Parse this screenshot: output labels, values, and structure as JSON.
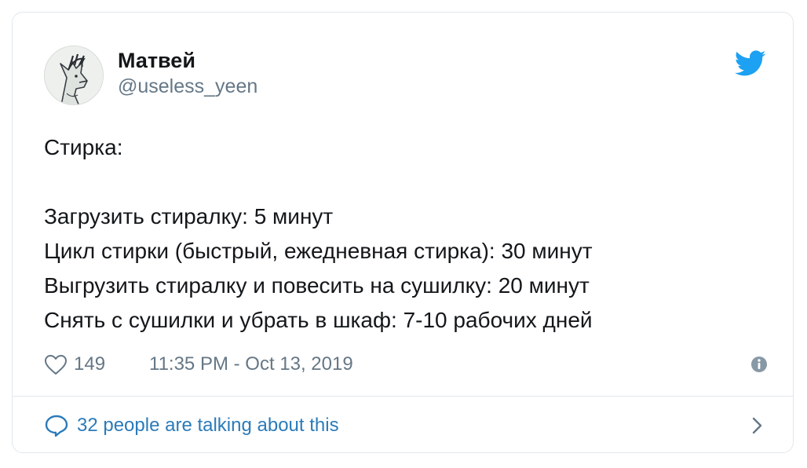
{
  "user": {
    "display_name": "Матвей",
    "handle": "@useless_yeen",
    "avatar_icon": "fox-sketch-avatar"
  },
  "tweet": {
    "lines": [
      "Стирка:",
      "",
      "Загрузить стиралку: 5 минут",
      "Цикл стирки (быстрый, ежедневная стирка): 30 минут",
      "Выгрузить стиралку и повесить на сушилку: 20 минут",
      "Снять с сушилки и убрать в шкаф: 7-10 рабочих дней"
    ]
  },
  "meta": {
    "like_count": "149",
    "timestamp": "11:35 PM - Oct 13, 2019"
  },
  "conversation": {
    "label": "32 people are talking about this"
  },
  "colors": {
    "text": "#14171a",
    "secondary": "#657786",
    "link": "#2b7bb9",
    "twitter_blue": "#1da1f2",
    "border": "#e1e8ed"
  },
  "icons": {
    "brand": "twitter-bird-icon",
    "like": "heart-icon",
    "info": "info-icon",
    "conversation": "speech-bubble-icon",
    "more": "chevron-right-icon"
  }
}
